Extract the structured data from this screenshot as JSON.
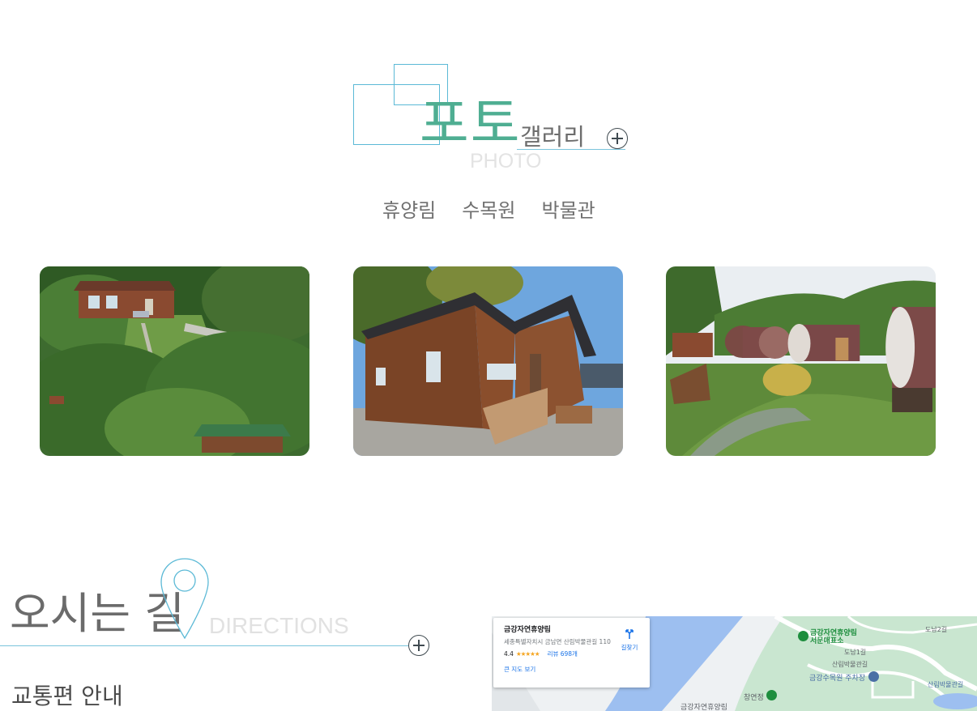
{
  "gallery": {
    "title_big": "포토",
    "title_small": "갤러리",
    "subtitle": "PHOTO",
    "tabs": [
      "휴양림",
      "수목원",
      "박물관"
    ],
    "photos": [
      {
        "alt": "forest-lodge-on-hillside"
      },
      {
        "alt": "wooden-cabin"
      },
      {
        "alt": "barrel-cabins"
      }
    ]
  },
  "directions": {
    "title": "오시는 길",
    "subtitle": "DIRECTIONS",
    "traffic_title": "교통편 안내"
  },
  "map": {
    "place_name": "금강자연휴양림",
    "address": "세종특별자치시 금남면 산림박물관길 110",
    "rating": "4.4",
    "stars": "★★★★★",
    "reviews": "리뷰 698개",
    "directions_label": "길찾기",
    "bigger_map": "큰 지도 보기",
    "labels": {
      "forest_office": "금강자연휴양림",
      "forest_office_sub": "서문매표소",
      "doro": "도남1길",
      "doro2": "도남2길",
      "museum_road": "산림박물관길",
      "arboretum_parking": "금강수목원 주차장",
      "changyeonjeong": "창연정",
      "forest_bottom": "금강자연휴양림",
      "museum": "산림박물관길"
    }
  },
  "colors": {
    "accent_green": "#4fae92",
    "line_blue": "#7ac4dc",
    "text_gray": "#6b6b6b",
    "map_water": "#9dbff0",
    "map_park": "#c9e6d0"
  }
}
